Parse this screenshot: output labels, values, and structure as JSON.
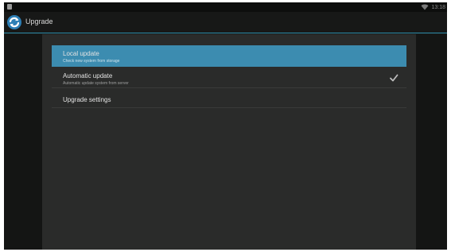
{
  "status_bar": {
    "time": "13:18",
    "left_icon": "notification-icon",
    "signal_icon": "wifi-icon"
  },
  "action_bar": {
    "title": "Upgrade",
    "app_icon": "upgrade-refresh-icon",
    "divider_color": "#2c8aa8"
  },
  "preferences": [
    {
      "title": "Local update",
      "summary": "Check new system from storage",
      "selected": true
    },
    {
      "title": "Automatic update",
      "summary": "Automatic update system from server",
      "checked": true,
      "check_icon": "checkmark-icon"
    },
    {
      "title": "Upgrade settings",
      "summary": ""
    }
  ],
  "colors": {
    "accent": "#3c8cb0",
    "background": "#2a2b2a"
  }
}
